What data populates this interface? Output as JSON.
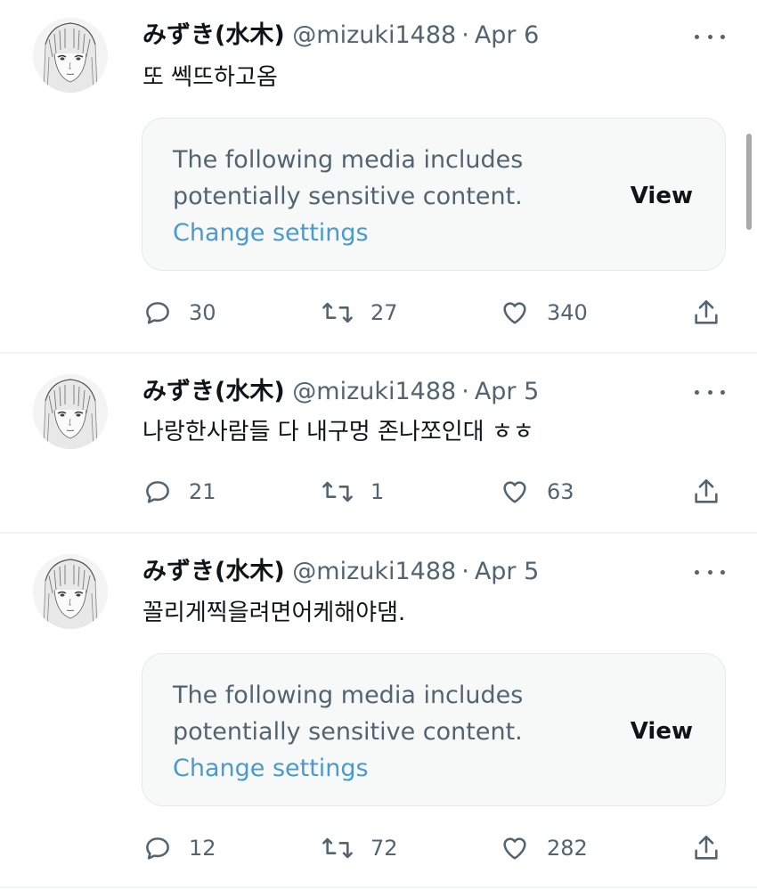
{
  "colors": {
    "text": "#0f1419",
    "secondary": "#536471",
    "link": "#4a99cf",
    "divider": "#eff3f4"
  },
  "tweets": [
    {
      "name": "みずき(水木)",
      "handle": "@mizuki1488",
      "separator": "·",
      "date": "Apr 6",
      "text": "또 쎅뜨하고옴",
      "media": {
        "line1": "The following media includes",
        "line2": "potentially sensitive content.",
        "link": "Change settings",
        "view": "View"
      },
      "replies": "30",
      "retweets": "27",
      "likes": "340"
    },
    {
      "name": "みずき(水木)",
      "handle": "@mizuki1488",
      "separator": "·",
      "date": "Apr 5",
      "text": "나랑한사람들 다 내구멍 존나쪼인대 ㅎㅎ",
      "replies": "21",
      "retweets": "1",
      "likes": "63"
    },
    {
      "name": "みずき(水木)",
      "handle": "@mizuki1488",
      "separator": "·",
      "date": "Apr 5",
      "text": "꼴리게찍을려면어케해야댐.",
      "media": {
        "line1": "The following media includes",
        "line2": "potentially sensitive content.",
        "link": "Change settings",
        "view": "View"
      },
      "replies": "12",
      "retweets": "72",
      "likes": "282"
    }
  ]
}
